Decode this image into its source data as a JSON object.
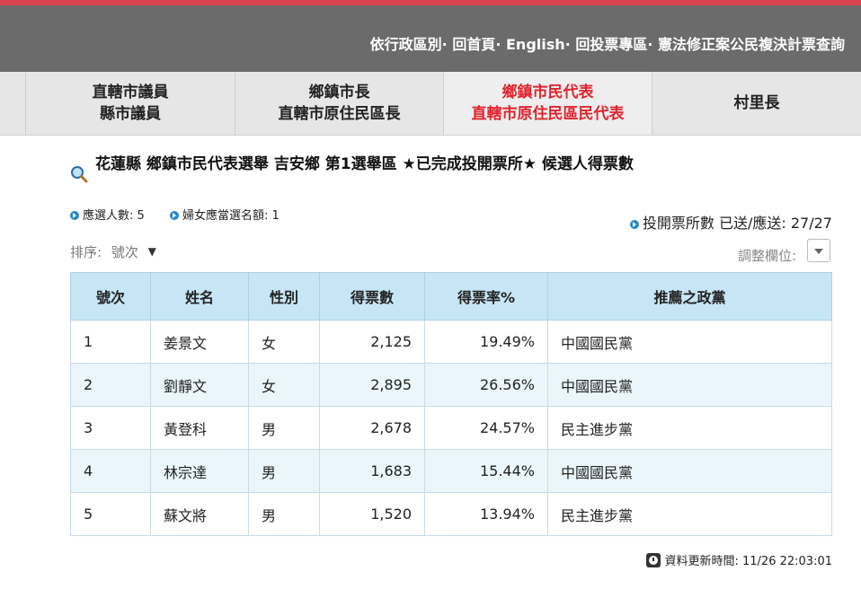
{
  "top_nav": [
    "依行政區別·",
    "回首頁·",
    "English·",
    "回投票專區·",
    "憲法修正案公民複決計票查詢"
  ],
  "tabs": [
    {
      "line1": "直轄市議員",
      "line2": "縣市議員"
    },
    {
      "line1": "鄉鎮市長",
      "line2": "直轄市原住民區長"
    },
    {
      "line1": "鄉鎮市民代表",
      "line2": "直轄市原住民區民代表"
    },
    {
      "line1": "村里長",
      "line2": ""
    }
  ],
  "title": "花蓮縣 鄉鎮市民代表選舉 吉安鄉 第1選舉區 ★已完成投開票所★ 候選人得票數",
  "info": {
    "elected_count": "應選人數: 5",
    "women_quota": "婦女應當選名額: 1",
    "stations": "投開票所數 已送/應送: 27/27"
  },
  "sort": {
    "label": "排序:",
    "value": "號次"
  },
  "adjust_label": "調整欄位:",
  "table": {
    "headers": [
      "號次",
      "姓名",
      "性別",
      "得票數",
      "得票率%",
      "推薦之政黨"
    ],
    "rows": [
      [
        "1",
        "姜景文",
        "女",
        "2,125",
        "19.49%",
        "中國國民黨"
      ],
      [
        "2",
        "劉靜文",
        "女",
        "2,895",
        "26.56%",
        "中國國民黨"
      ],
      [
        "3",
        "黃登科",
        "男",
        "2,678",
        "24.57%",
        "民主進步黨"
      ],
      [
        "4",
        "林宗達",
        "男",
        "1,683",
        "15.44%",
        "中國國民黨"
      ],
      [
        "5",
        "蘇文將",
        "男",
        "1,520",
        "13.94%",
        "民主進步黨"
      ]
    ]
  },
  "update_time": "資料更新時間: 11/26 22:03:01",
  "icons": [
    "search-icon",
    "bullet-arrow-icon",
    "sort-caret-icon",
    "dropdown-caret-icon",
    "clock-icon"
  ],
  "colors": {
    "header_bar": "#6b6b6b",
    "accent_red": "#e0242e",
    "table_header": "#c7e6f5",
    "row_alt": "#eaf6fc"
  }
}
